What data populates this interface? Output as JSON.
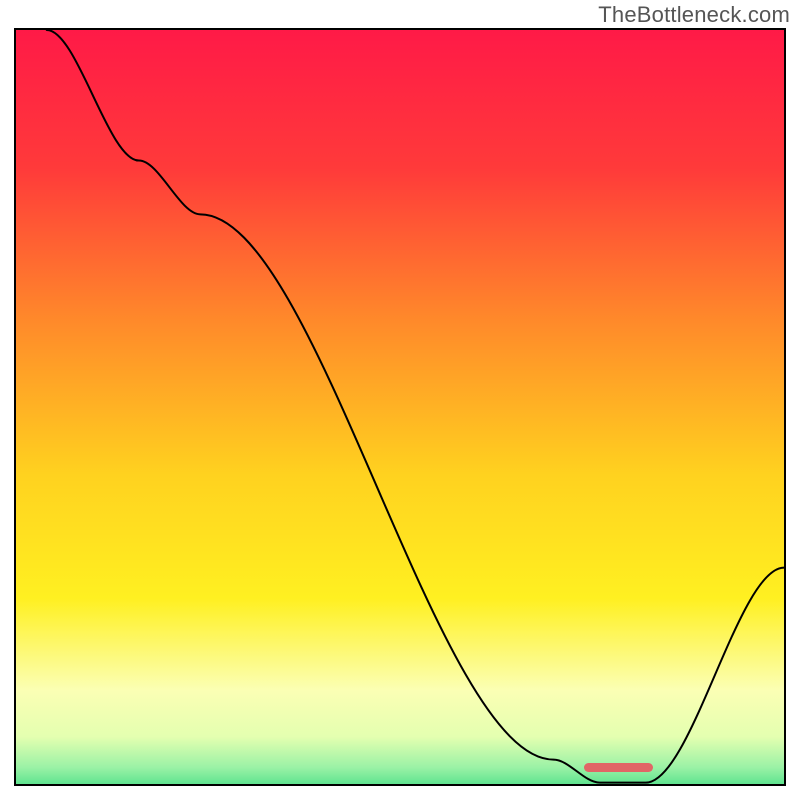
{
  "watermark": "TheBottleneck.com",
  "chart_data": {
    "type": "line",
    "title": "",
    "xlabel": "",
    "ylabel": "",
    "xlim": [
      0,
      100
    ],
    "ylim": [
      0,
      100
    ],
    "gradient_stops": [
      {
        "pct": 0,
        "color": "#ff1a47"
      },
      {
        "pct": 18,
        "color": "#ff3a3a"
      },
      {
        "pct": 38,
        "color": "#ff8a2a"
      },
      {
        "pct": 58,
        "color": "#ffd21f"
      },
      {
        "pct": 74,
        "color": "#fff021"
      },
      {
        "pct": 86,
        "color": "#fbffb4"
      },
      {
        "pct": 92,
        "color": "#e4ffb0"
      },
      {
        "pct": 96,
        "color": "#9bf2a6"
      },
      {
        "pct": 100,
        "color": "#2fd87d"
      }
    ],
    "series": [
      {
        "name": "bottleneck-curve",
        "x": [
          4,
          16,
          24,
          70,
          76,
          82,
          100
        ],
        "y": [
          100,
          83,
          76,
          5,
          2,
          2,
          30
        ]
      }
    ],
    "marker": {
      "x_start": 74,
      "x_end": 83,
      "y": 2.2,
      "height_pct": 1.3
    },
    "grid": false,
    "legend": false
  }
}
